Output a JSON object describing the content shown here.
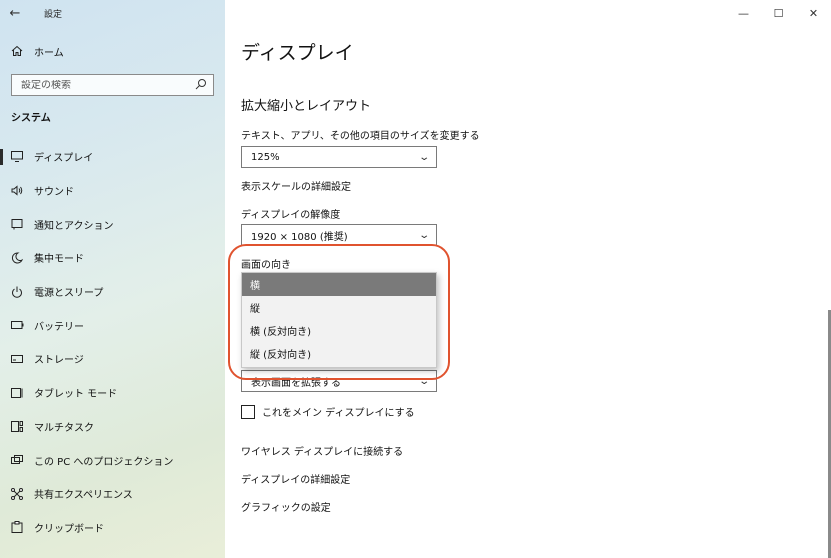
{
  "window": {
    "app_title": "設定",
    "back_glyph": "←",
    "minimize_glyph": "—",
    "maximize_glyph": "☐",
    "close_glyph": "✕"
  },
  "sidebar": {
    "home_label": "ホーム",
    "search_placeholder": "設定の検索",
    "section_header": "システム",
    "items": [
      {
        "label": "ディスプレイ",
        "icon": "monitor-icon",
        "active": true
      },
      {
        "label": "サウンド",
        "icon": "speaker-icon"
      },
      {
        "label": "通知とアクション",
        "icon": "notification-icon"
      },
      {
        "label": "集中モード",
        "icon": "moon-icon"
      },
      {
        "label": "電源とスリープ",
        "icon": "power-icon"
      },
      {
        "label": "バッテリー",
        "icon": "battery-icon"
      },
      {
        "label": "ストレージ",
        "icon": "storage-icon"
      },
      {
        "label": "タブレット モード",
        "icon": "tablet-icon"
      },
      {
        "label": "マルチタスク",
        "icon": "multitask-icon"
      },
      {
        "label": "この PC へのプロジェクション",
        "icon": "projection-icon"
      },
      {
        "label": "共有エクスペリエンス",
        "icon": "shared-icon"
      },
      {
        "label": "クリップボード",
        "icon": "clipboard-icon"
      }
    ]
  },
  "main": {
    "page_title": "ディスプレイ",
    "scale_section": "拡大縮小とレイアウト",
    "scale_label": "テキスト、アプリ、その他の項目のサイズを変更する",
    "scale_value": "125%",
    "advanced_scale_link": "表示スケールの詳細設定",
    "resolution_label": "ディスプレイの解像度",
    "resolution_value": "1920 × 1080 (推奨)",
    "orientation_label": "画面の向き",
    "orientation_options": [
      "横",
      "縦",
      "横 (反対向き)",
      "縦 (反対向き)"
    ],
    "orientation_selected_index": 0,
    "multi_display_value": "表示画面を拡張する",
    "main_display_checkbox_label": "これをメイン ディスプレイにする",
    "main_display_checked": false,
    "wireless_link": "ワイヤレス ディスプレイに接続する",
    "advanced_display_link": "ディスプレイの詳細設定",
    "graphics_link": "グラフィックの設定",
    "highlight_color": "#e0532f"
  }
}
